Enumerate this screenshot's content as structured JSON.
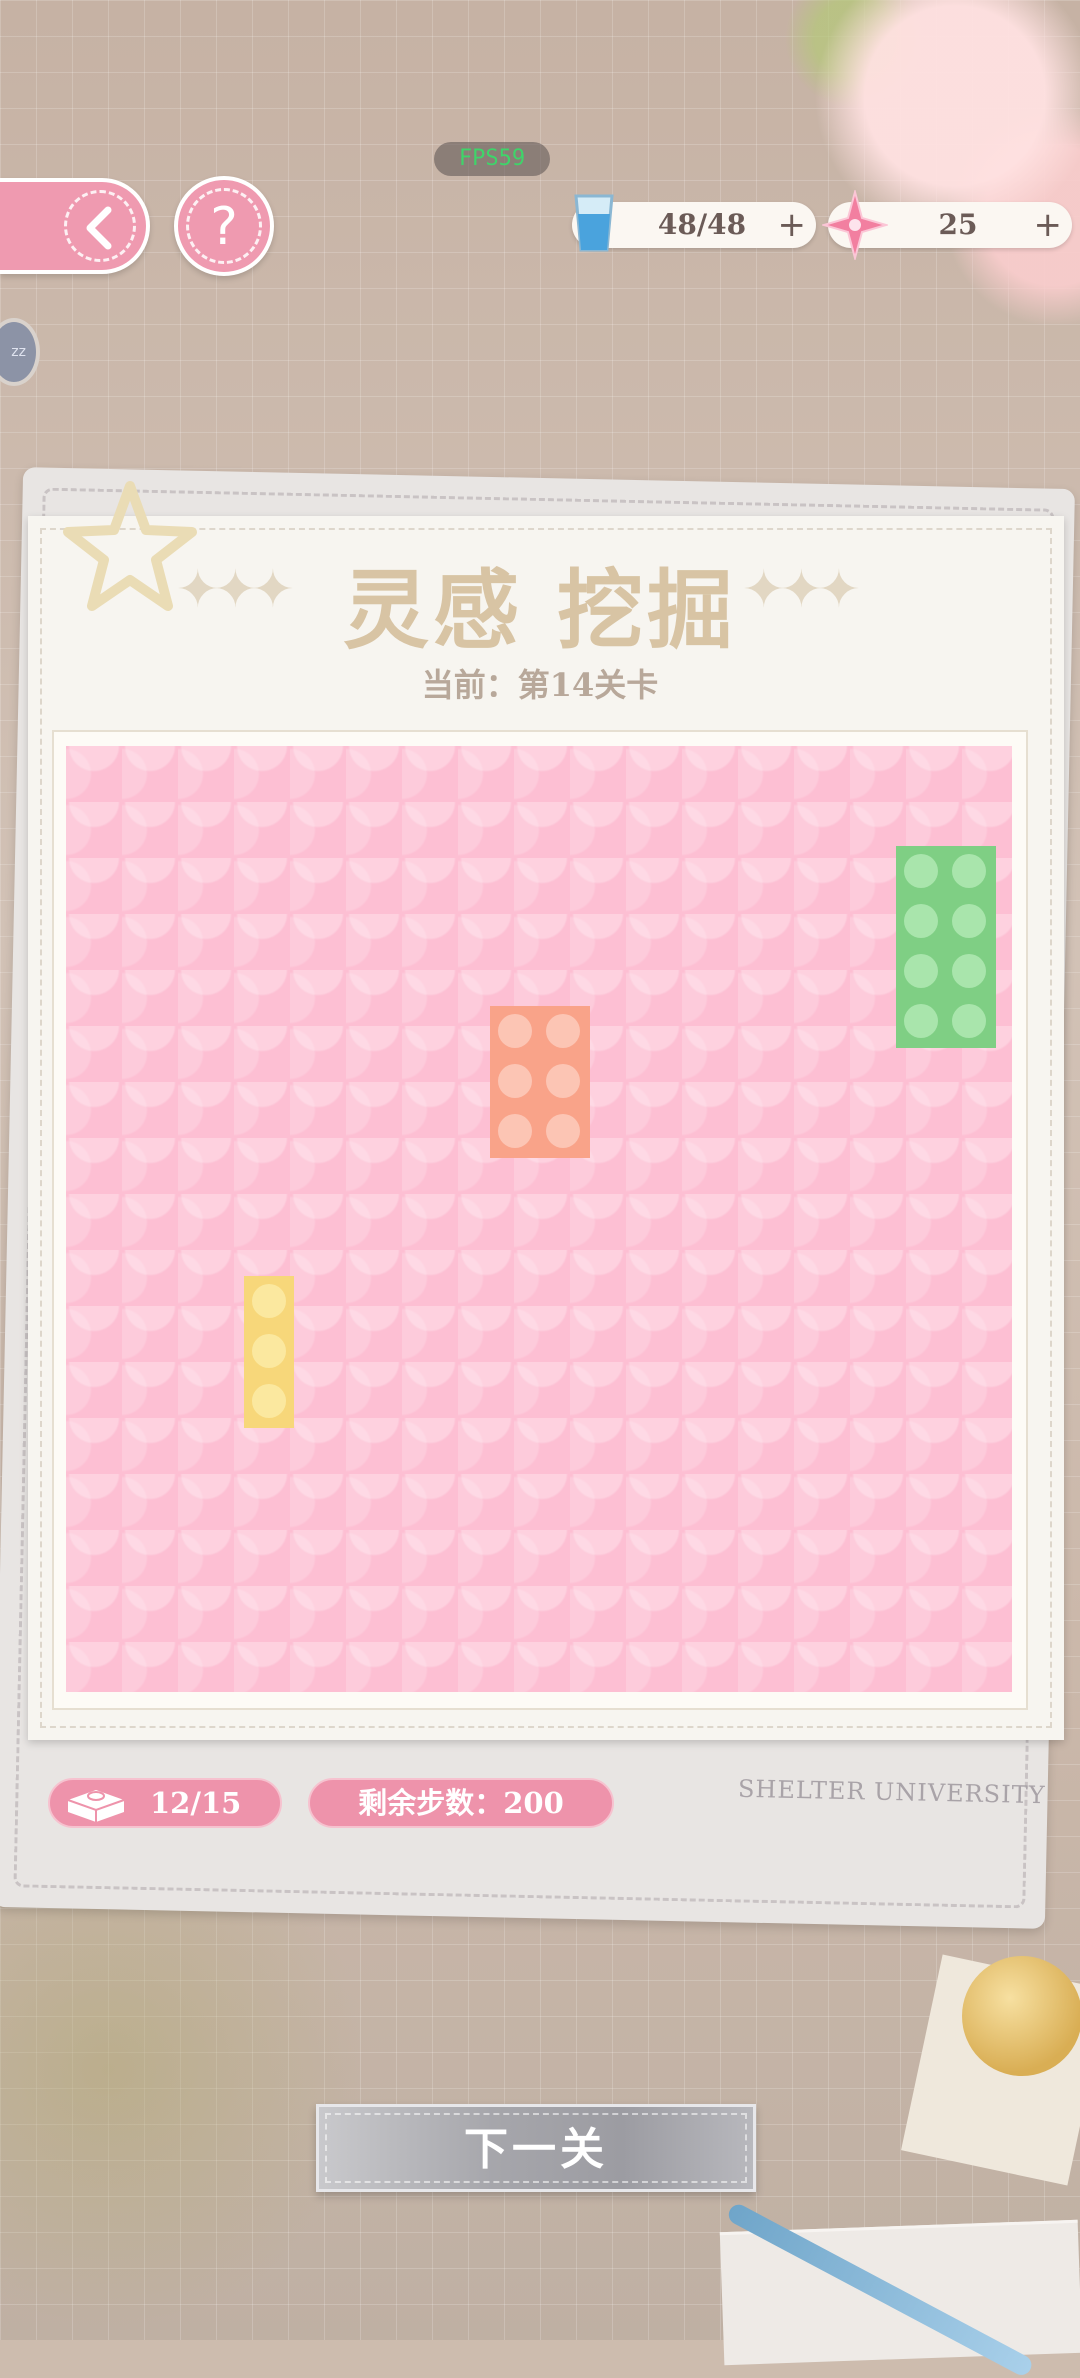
{
  "hud": {
    "fps": "FPS59",
    "water": "48/48",
    "gems": "25",
    "plus": "+",
    "side_badge": "zz"
  },
  "card": {
    "title": "灵感 挖掘",
    "subtitle": "当前：第14关卡",
    "university": "SHELTER UNIVERSITY"
  },
  "board": {
    "background_color": "#fdbfd3",
    "blocks": [
      {
        "color": "green",
        "studs_cols": 2,
        "studs_rows": 4
      },
      {
        "color": "orange",
        "studs_cols": 2,
        "studs_rows": 3
      },
      {
        "color": "yellow",
        "studs_cols": 1,
        "studs_rows": 3
      }
    ]
  },
  "footer": {
    "bricks_count": "12/15",
    "steps_left": "剩余步数：200",
    "next_label": "下一关"
  },
  "colors": {
    "pink_accent": "#ef9ab0",
    "green_block": "#7fcf84",
    "orange_block": "#f9a389",
    "yellow_block": "#f7d77a"
  }
}
